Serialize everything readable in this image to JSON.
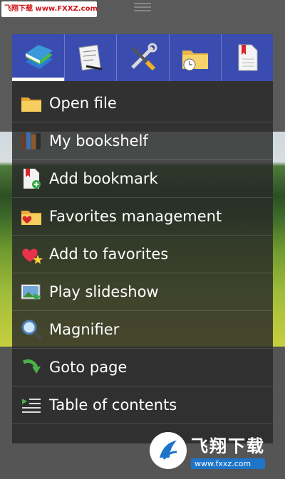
{
  "watermark": {
    "top_text": "飞翔下载 www.FXXZ.com",
    "brand_cn": "飞翔下载",
    "brand_url": "www.fxxz.com"
  },
  "tabs": [
    {
      "name": "library-books-icon",
      "active": true
    },
    {
      "name": "notes-pencil-icon",
      "active": false
    },
    {
      "name": "tools-icon",
      "active": false
    },
    {
      "name": "folder-clock-icon",
      "active": false
    },
    {
      "name": "document-bookmark-icon",
      "active": false
    }
  ],
  "menu": {
    "items": [
      {
        "label": "Open file",
        "icon": "folder-icon"
      },
      {
        "label": "My bookshelf",
        "icon": "bookshelf-icon"
      },
      {
        "label": "Add bookmark",
        "icon": "add-bookmark-icon"
      },
      {
        "label": "Favorites management",
        "icon": "favorites-folder-icon"
      },
      {
        "label": "Add to favorites",
        "icon": "heart-star-icon"
      },
      {
        "label": "Play slideshow",
        "icon": "slideshow-icon"
      },
      {
        "label": "Magnifier",
        "icon": "magnifier-icon"
      },
      {
        "label": "Goto page",
        "icon": "goto-arrow-icon"
      },
      {
        "label": "Table of contents",
        "icon": "toc-icon"
      }
    ]
  },
  "colors": {
    "tabbar": "#3b4cb0",
    "menu_bg": "#282828"
  }
}
